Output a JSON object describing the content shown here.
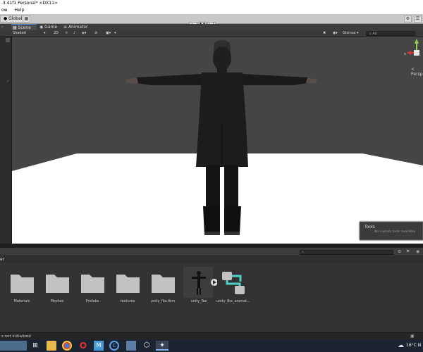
{
  "window": {
    "title": ".3.41f1 Personal* <DX11>"
  },
  "menu": {
    "items": [
      "ow",
      "Help"
    ]
  },
  "toolbar": {
    "global_label": "Global",
    "play_icons": [
      "play-icon",
      "pause-icon",
      "step-icon"
    ]
  },
  "tabs": [
    {
      "label": "Scene",
      "icon": "grid-icon"
    },
    {
      "label": "Game",
      "icon": "gamepad-icon"
    },
    {
      "label": "Animator",
      "icon": "animator-icon"
    }
  ],
  "scene_toolbar": {
    "shading_mode": "Shaded",
    "mode_2d": "2D",
    "gizmos_label": "Gizmos",
    "search_placeholder": "All"
  },
  "viewport": {
    "projection_label": "< Persp",
    "background_color": "#454545",
    "floor_color": "#ffffff"
  },
  "tools_overlay": {
    "title": "Tools",
    "message": "No custom tools available"
  },
  "project": {
    "header": "er",
    "assets": [
      {
        "label": "Materials",
        "icon": "folder-icon"
      },
      {
        "label": "Meshes",
        "icon": "folder-icon"
      },
      {
        "label": "Prefabs",
        "icon": "folder-icon"
      },
      {
        "label": "textures",
        "icon": "folder-icon"
      },
      {
        "label": "unity_fbx.fbm",
        "icon": "folder-icon"
      },
      {
        "label": "unity_fbx",
        "icon": "model-icon"
      },
      {
        "label": "unity_fbx_animat...",
        "icon": "animator-controller-icon"
      }
    ]
  },
  "status": {
    "message": "s not initialized"
  },
  "taskbar": {
    "temperature": "16°C",
    "tray_extra": "N"
  }
}
